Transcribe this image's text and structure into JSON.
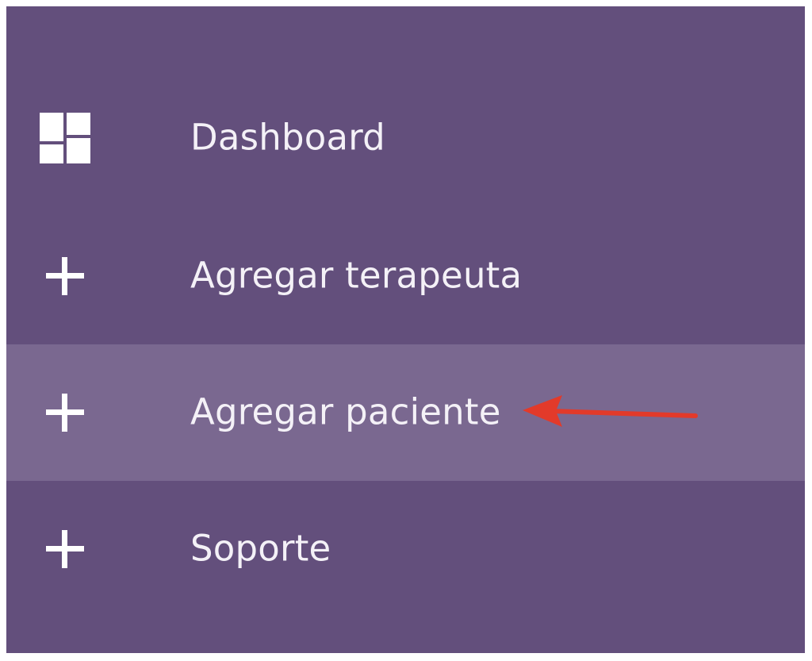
{
  "sidebar": {
    "items": [
      {
        "label": "Dashboard",
        "icon": "dashboard-grid-icon",
        "active": false
      },
      {
        "label": "Agregar terapeuta",
        "icon": "plus-icon",
        "active": false
      },
      {
        "label": "Agregar paciente",
        "icon": "plus-icon",
        "active": true
      },
      {
        "label": "Soporte",
        "icon": "plus-icon",
        "active": false
      }
    ]
  },
  "annotation": {
    "type": "arrow",
    "color": "#e23a2a",
    "points_to": "Agregar paciente"
  },
  "colors": {
    "sidebar_background": "#634f7c",
    "active_item_background": "#7a6890",
    "text": "#f4f1f7"
  }
}
